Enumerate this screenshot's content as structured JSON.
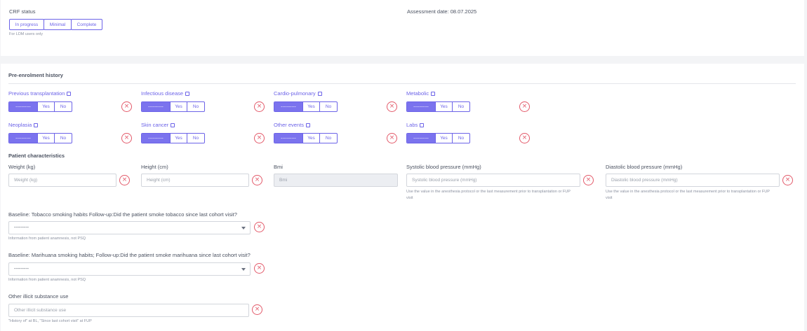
{
  "crf": {
    "label": "CRF status",
    "options": [
      "In progress",
      "Minimal",
      "Complete"
    ],
    "hint": "For LDM users only",
    "assessment_date": "Assessment date: 08.07.2025"
  },
  "pre_enrolment": {
    "title": "Pre-enrolment history",
    "empty_option": "----------",
    "yes": "Yes",
    "no": "No",
    "items": [
      {
        "label": "Previous transplantation"
      },
      {
        "label": "Infectious disease"
      },
      {
        "label": "Cardio-pulmonary"
      },
      {
        "label": "Metabolic"
      },
      {
        "label": "Neoplasia"
      },
      {
        "label": "Skin cancer"
      },
      {
        "label": "Other events"
      },
      {
        "label": "Labs"
      }
    ]
  },
  "patient": {
    "title": "Patient characteristics",
    "weight": {
      "label": "Weight (kg)",
      "placeholder": "Weight (kg)"
    },
    "height": {
      "label": "Height (cm)",
      "placeholder": "Height (cm)"
    },
    "bmi": {
      "label": "Bmi",
      "placeholder": "Bmi"
    },
    "systolic": {
      "label": "Systolic blood pressure (mmHg)",
      "placeholder": "Systolic blood pressure (mmHg)",
      "hint1": "Use the value in the anesthesia protocol or the last measurement prior to transplantation or FUP",
      "hint2": "visit"
    },
    "diastolic": {
      "label": "Diastolic blood pressure (mmHg)",
      "placeholder": "Diastolic blood pressure (mmHg)",
      "hint1": "Use the value in the anesthesia protocol or the last measurement prior to transplantation or FUP",
      "hint2": "visit"
    },
    "tobacco": {
      "label": "Baseline: Tobacco smoking habits Follow-up:Did the patient smoke tobacco since last cohort visit?",
      "value": "---------",
      "hint": "Information from patient anamnesis, not PSQ"
    },
    "marihuana": {
      "label": "Baseline: Marihuana smoking habits; Follow-up:Did the patient smoke marihuana since last cohort visit?",
      "value": "---------",
      "hint": "Information from patient anamnesis, not PSQ"
    },
    "illicit": {
      "label": "Other illicit substance use",
      "placeholder": "Other illicit substance use",
      "hint": "\"History of\" at BL, \"Since last cohort visit\" at FUP"
    }
  },
  "colors": {
    "accent": "#6c63e8",
    "accent_fill": "#7b73ee",
    "clear": "#e35a6a"
  },
  "icons": {
    "clear": "close-circle-icon",
    "external": "external-link-icon",
    "dropdown": "chevron-down-icon"
  }
}
